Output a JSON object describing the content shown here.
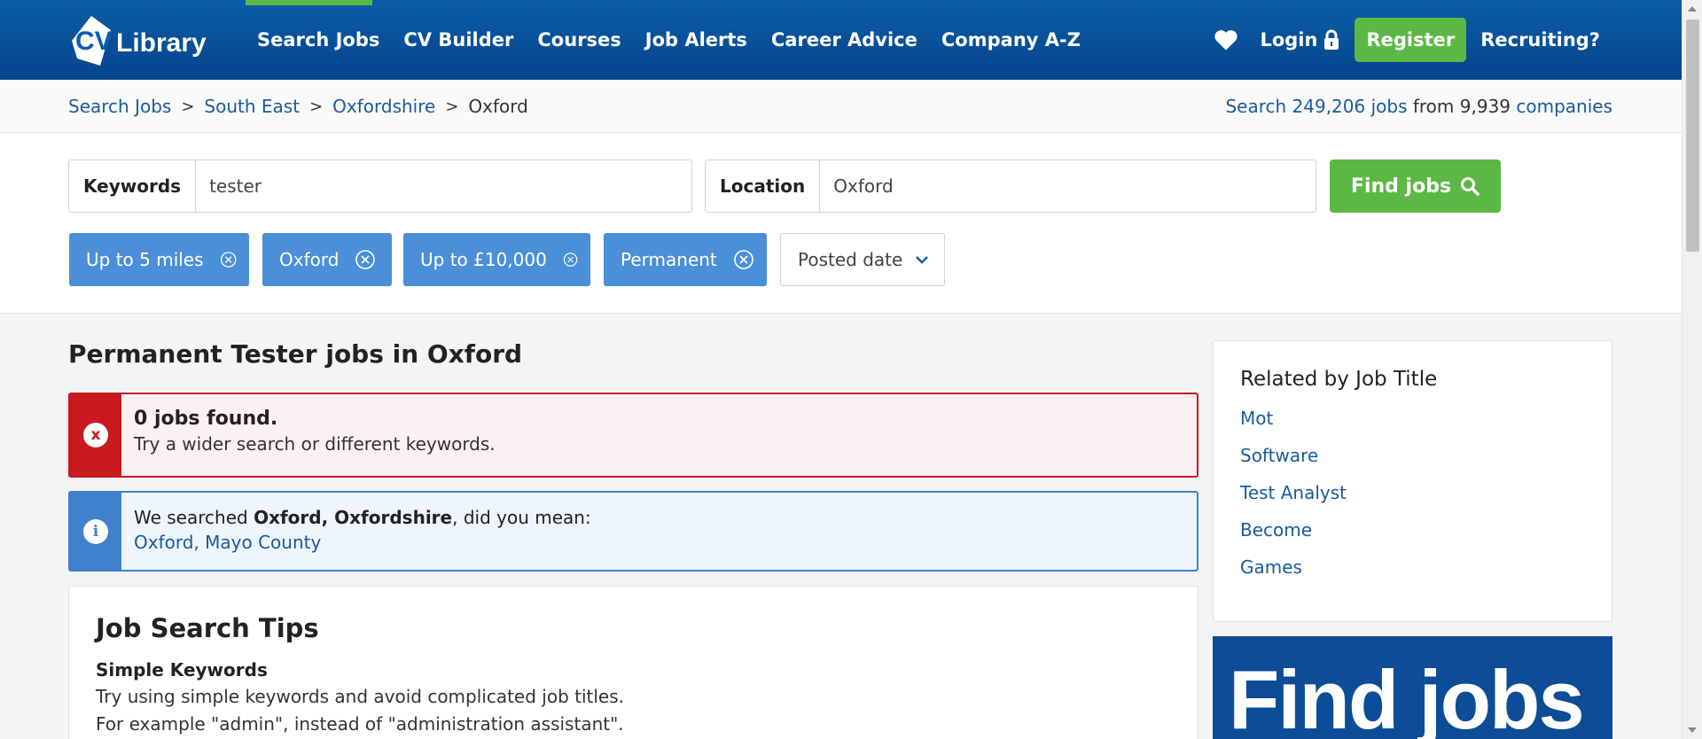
{
  "header": {
    "logo_text": "CV Library",
    "nav": [
      "Search Jobs",
      "CV Builder",
      "Courses",
      "Job Alerts",
      "Career Advice",
      "Company A-Z"
    ],
    "active_nav": "Search Jobs",
    "login": "Login",
    "register": "Register",
    "recruiting": "Recruiting?",
    "colors": {
      "bar": "#06448a",
      "accent": "#5cb845"
    },
    "icons": [
      "heart-icon",
      "lock-icon"
    ]
  },
  "breadcrumb": {
    "items": [
      "Search Jobs",
      "South East",
      "Oxfordshire"
    ],
    "current": "Oxford",
    "separator": ">"
  },
  "stats": {
    "search_link": "Search 249,206 jobs",
    "from": " from 9,939 ",
    "companies_link": "companies"
  },
  "search": {
    "keywords_label": "Keywords",
    "keywords_value": "tester",
    "location_label": "Location",
    "location_value": "Oxford",
    "find_button": "Find jobs",
    "filters": [
      "Up to 5 miles",
      "Oxford",
      "Up to £10,000",
      "Permanent"
    ],
    "sort_dropdown": "Posted date"
  },
  "results": {
    "title": "Permanent Tester jobs in Oxford",
    "error_title": "0 jobs found.",
    "error_text": "Try a wider search or different keywords.",
    "error_icon": "x",
    "info_prefix": "We searched ",
    "info_bold": "Oxford, Oxfordshire",
    "info_suffix": ", did you mean:",
    "info_link": "Oxford, Mayo County",
    "info_icon": "i"
  },
  "tips": {
    "title": "Job Search Tips",
    "subtitle": "Simple Keywords",
    "line1": "Try using simple keywords and avoid complicated job titles.",
    "line2": "For example \"admin\", instead of \"administration assistant\"."
  },
  "related": {
    "title": "Related by Job Title",
    "items": [
      "Mot",
      "Software",
      "Test Analyst",
      "Become",
      "Games"
    ]
  },
  "promo": {
    "text": "Find jobs"
  }
}
